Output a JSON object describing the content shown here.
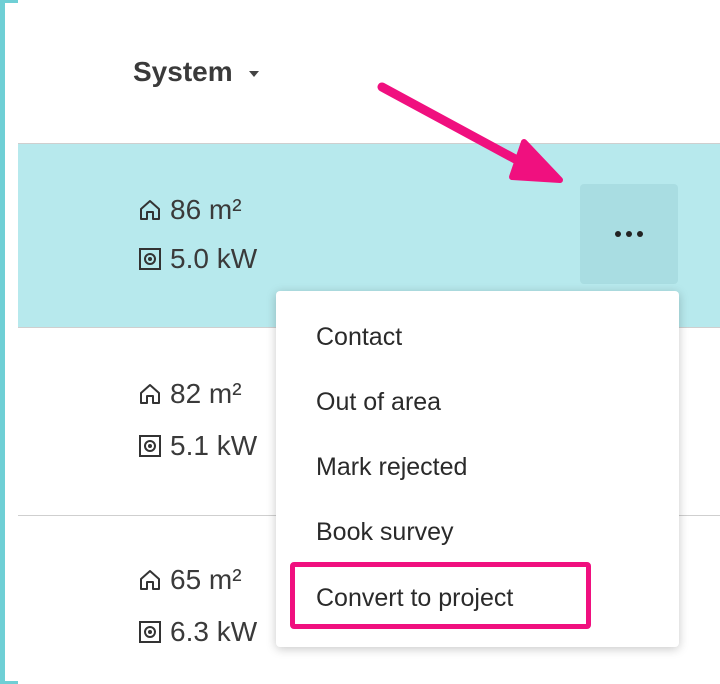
{
  "header": {
    "title": "System"
  },
  "rows": [
    {
      "area": "86 m²",
      "power": "5.0 kW"
    },
    {
      "area": "82 m²",
      "power": "5.1 kW"
    },
    {
      "area": "65 m²",
      "power": "6.3 kW"
    }
  ],
  "menu": {
    "items": [
      "Contact",
      "Out of area",
      "Mark rejected",
      "Book survey",
      "Convert to project"
    ]
  },
  "colors": {
    "frame": "#6fcfd5",
    "selected_row": "#b7e9ed",
    "more_button": "#a9dde2",
    "annotation": "#f0107f"
  },
  "icons": {
    "area": "house-icon",
    "power": "solar-panel-icon",
    "more": "more-dots-icon",
    "sort": "caret-down-icon"
  }
}
